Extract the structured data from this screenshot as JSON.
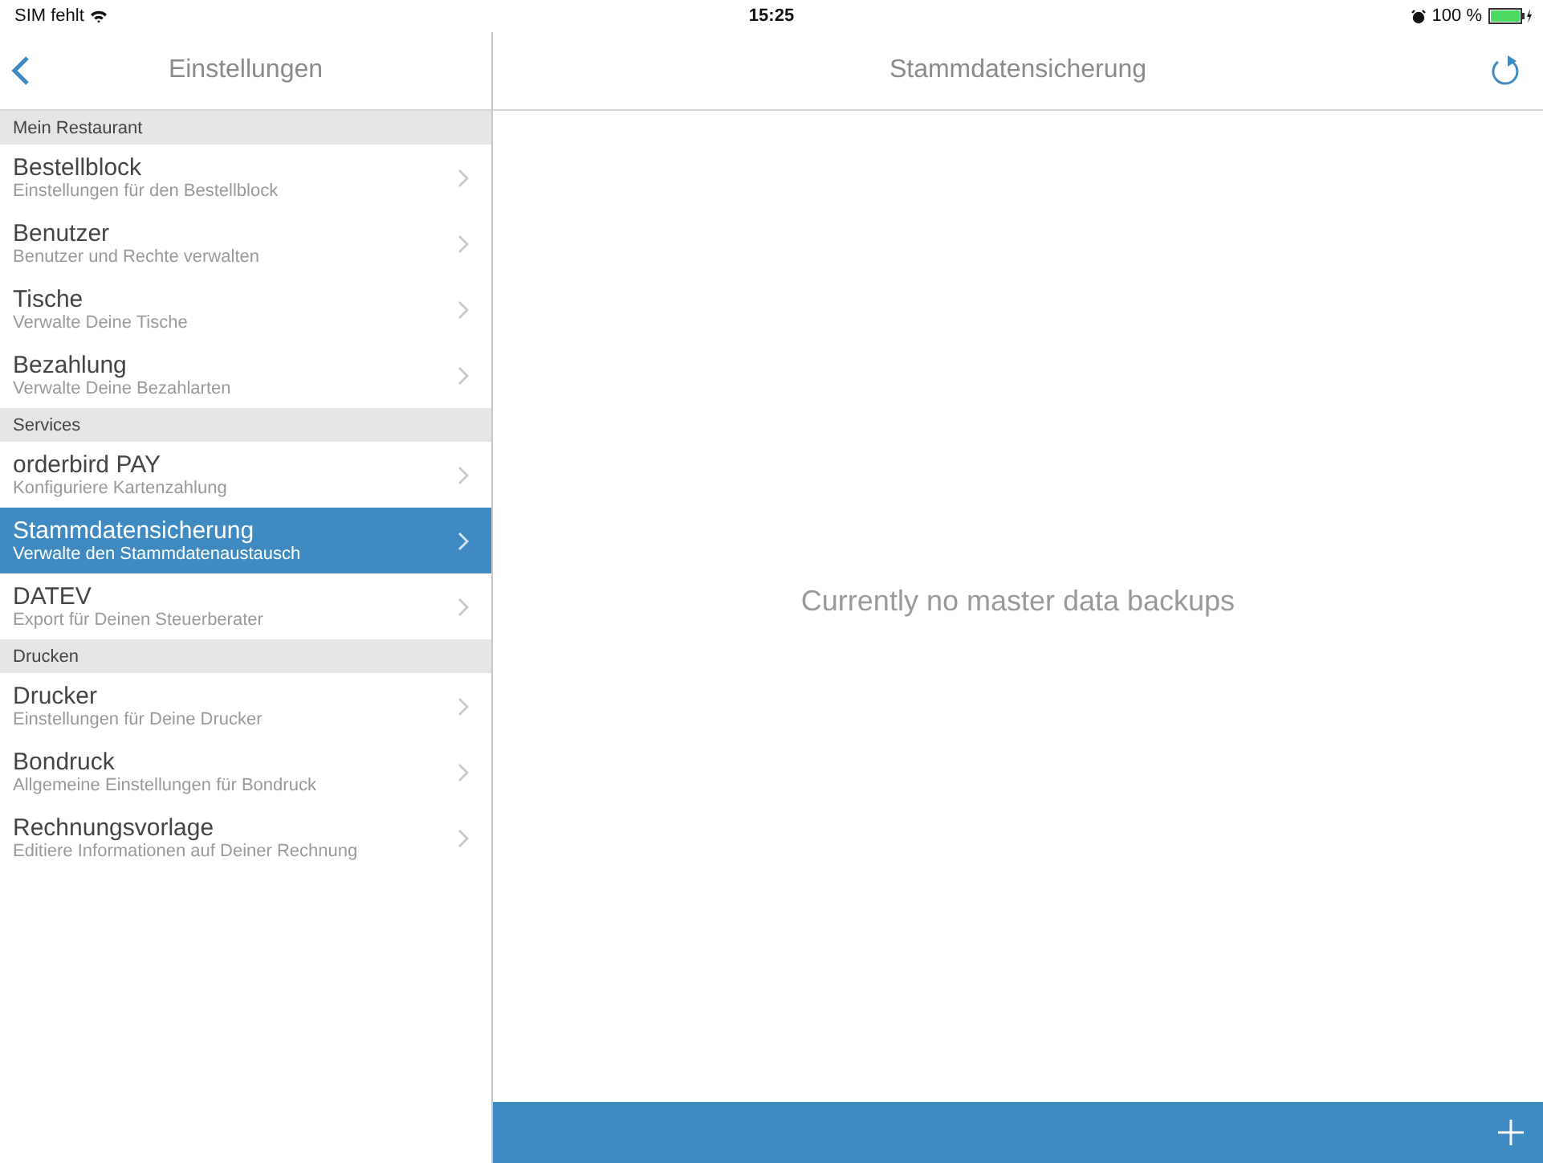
{
  "status_bar": {
    "carrier": "SIM fehlt",
    "time": "15:25",
    "battery": "100 %"
  },
  "sidebar": {
    "title": "Einstellungen",
    "sections": [
      {
        "header": "Mein Restaurant",
        "items": [
          {
            "title": "Bestellblock",
            "subtitle": "Einstellungen für den Bestellblock",
            "selected": false
          },
          {
            "title": "Benutzer",
            "subtitle": "Benutzer und Rechte verwalten",
            "selected": false
          },
          {
            "title": "Tische",
            "subtitle": "Verwalte Deine Tische",
            "selected": false
          },
          {
            "title": "Bezahlung",
            "subtitle": "Verwalte Deine Bezahlarten",
            "selected": false
          }
        ]
      },
      {
        "header": "Services",
        "items": [
          {
            "title": "orderbird PAY",
            "subtitle": "Konfiguriere Kartenzahlung",
            "selected": false
          },
          {
            "title": "Stammdatensicherung",
            "subtitle": "Verwalte den Stammdatenaustausch",
            "selected": true
          },
          {
            "title": "DATEV",
            "subtitle": "Export für Deinen Steuerberater",
            "selected": false
          }
        ]
      },
      {
        "header": "Drucken",
        "items": [
          {
            "title": "Drucker",
            "subtitle": "Einstellungen für Deine Drucker",
            "selected": false
          },
          {
            "title": "Bondruck",
            "subtitle": "Allgemeine Einstellungen für Bondruck",
            "selected": false
          },
          {
            "title": "Rechnungsvorlage",
            "subtitle": "Editiere Informationen auf Deiner Rechnung",
            "selected": false
          }
        ]
      }
    ]
  },
  "detail": {
    "title": "Stammdatensicherung",
    "empty_message": "Currently no master data backups"
  }
}
